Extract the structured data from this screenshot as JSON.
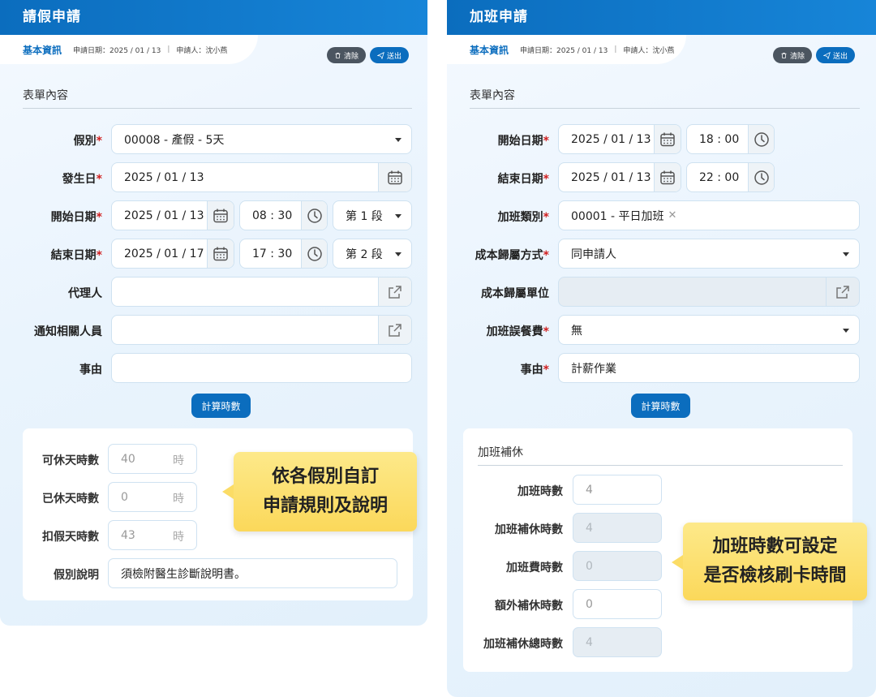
{
  "leave": {
    "title": "請假申請",
    "info_title": "基本資訊",
    "apply_date": "申請日期：2025 / 01 / 13",
    "applicant": "申請人：沈小燕",
    "clear_label": "清除",
    "send_label": "送出",
    "section_title": "表單內容",
    "fields": {
      "type_label": "假別",
      "type_value": "00008 - 產假 - 5天",
      "occur_label": "發生日",
      "occur_value": "2025 / 01 / 13",
      "start_label": "開始日期",
      "start_date": "2025 / 01 / 13",
      "start_time": "08 : 30",
      "start_segment": "第 1 段",
      "end_label": "結束日期",
      "end_date": "2025 / 01 / 17",
      "end_time": "17 : 30",
      "end_segment": "第 2 段",
      "agent_label": "代理人",
      "agent_value": "",
      "notify_label": "通知相關人員",
      "notify_value": "",
      "reason_label": "事由",
      "reason_value": ""
    },
    "calc_label": "計算時數",
    "summary": {
      "available_label": "可休天時數",
      "available_value": "40",
      "used_label": "已休天時數",
      "used_value": "0",
      "deduct_label": "扣假天時數",
      "deduct_value": "43",
      "unit": "時",
      "desc_label": "假別說明",
      "desc_value": "須檢附醫生診斷說明書。"
    },
    "callout": [
      "依各假別自訂",
      "申請規則及說明"
    ]
  },
  "overtime": {
    "title": "加班申請",
    "info_title": "基本資訊",
    "apply_date": "申請日期：2025 / 01 / 13",
    "applicant": "申請人：沈小燕",
    "clear_label": "清除",
    "send_label": "送出",
    "section_title": "表單內容",
    "fields": {
      "start_label": "開始日期",
      "start_date": "2025 / 01 / 13",
      "start_time": "18 : 00",
      "end_label": "結束日期",
      "end_date": "2025 / 01 / 13",
      "end_time": "22 : 00",
      "type_label": "加班類別",
      "type_value": "00001 - 平日加班",
      "cost_method_label": "成本歸屬方式",
      "cost_method_value": "同申請人",
      "cost_unit_label": "成本歸屬單位",
      "cost_unit_value": "",
      "meal_label": "加班誤餐費",
      "meal_value": "無",
      "reason_label": "事由",
      "reason_value": "計薪作業"
    },
    "calc_label": "計算時數",
    "comp": {
      "title": "加班補休",
      "hours_label": "加班時數",
      "hours_value": "4",
      "comp_label": "加班補休時數",
      "comp_value": "4",
      "fee_label": "加班費時數",
      "fee_value": "0",
      "extra_label": "額外補休時數",
      "extra_value": "0",
      "total_label": "加班補休總時數",
      "total_value": "4"
    },
    "callout": [
      "加班時數可設定",
      "是否檢核刷卡時間"
    ]
  },
  "colors": {
    "primary": "#0b6dbe",
    "required": "#d02020",
    "callout": "#fbd85a",
    "dark_button": "#4b5560"
  }
}
